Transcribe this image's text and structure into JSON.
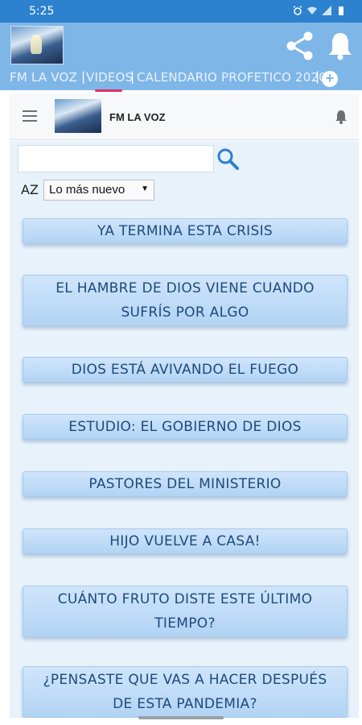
{
  "status_bar": {
    "time": "5:25"
  },
  "app": {
    "tabs": [
      {
        "label": "FM LA VOZ"
      },
      {
        "label": "VIDEOS"
      },
      {
        "label": "CALENDARIO PROFETICO 2020"
      }
    ],
    "add_tab_label": "+"
  },
  "web_header": {
    "title": "FM LA VOZ"
  },
  "search": {
    "value": "",
    "placeholder": ""
  },
  "sort": {
    "icon_label": "AZ",
    "selected": "Lo más nuevo"
  },
  "items": [
    {
      "label": "YA TERMINA ESTA CRISIS"
    },
    {
      "label": "EL HAMBRE DE DIOS VIENE CUANDO SUFRÍS POR ALGO"
    },
    {
      "label": "DIOS ESTÁ AVIVANDO EL FUEGO"
    },
    {
      "label": "ESTUDIO: EL GOBIERNO DE DIOS"
    },
    {
      "label": "PASTORES DEL MINISTERIO"
    },
    {
      "label": "HIJO VUELVE A CASA!"
    },
    {
      "label": "CUÁNTO FRUTO DISTE ESTE ÚLTIMO TIEMPO?"
    },
    {
      "label": "¿PENSASTE QUE VAS A HACER DESPUÉS DE ESTA PANDEMIA?"
    }
  ],
  "colors": {
    "status_bar": "#2c82cf",
    "app_header": "#7fb6e8",
    "active_tab_indicator": "#e0306b",
    "button_text": "#1e4a7a",
    "content_bg": "#e8f2fb"
  },
  "icons": {
    "share": "share-icon",
    "bell": "bell-icon",
    "search": "search-icon",
    "menu": "hamburger-icon"
  }
}
